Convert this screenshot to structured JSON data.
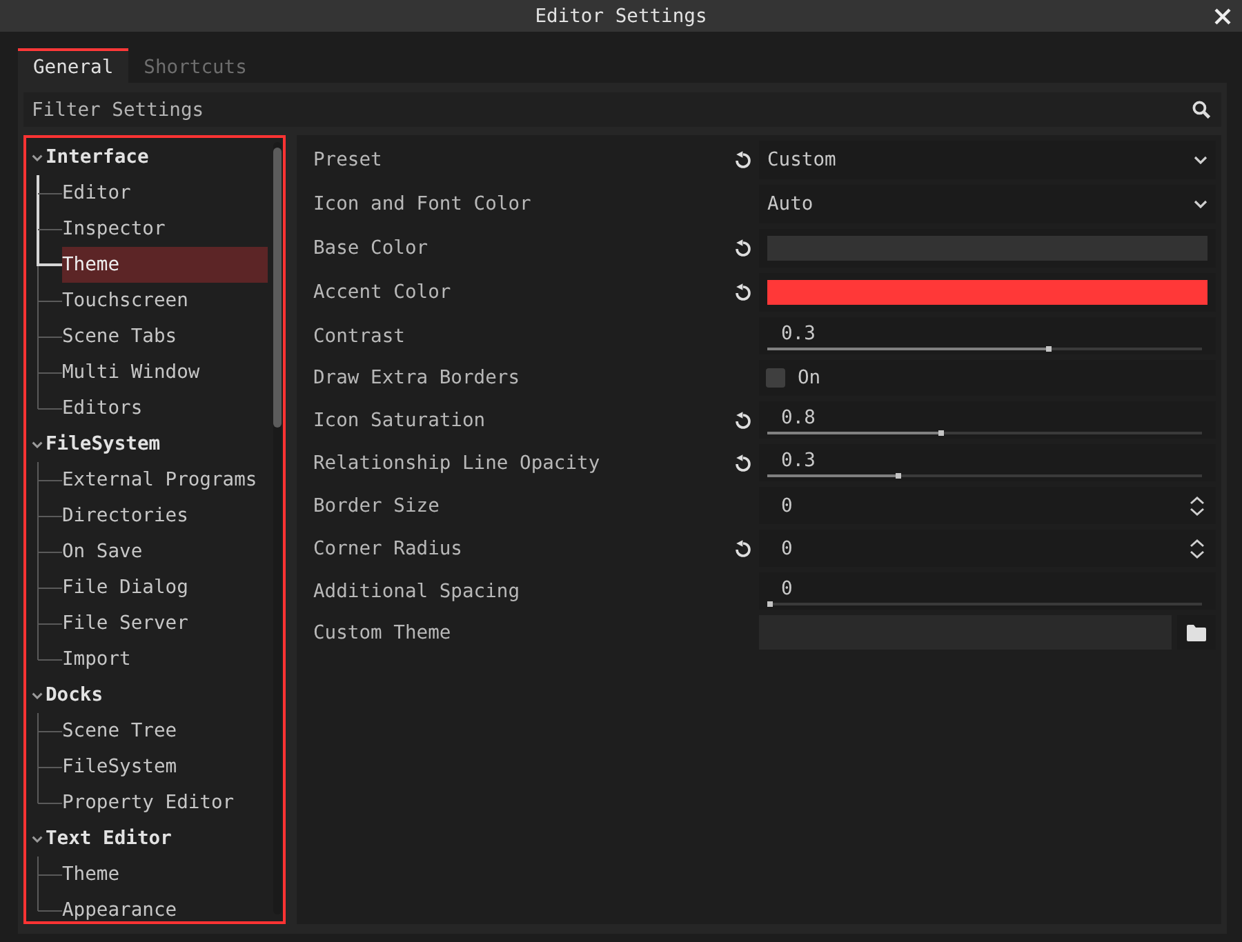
{
  "window": {
    "title": "Editor Settings"
  },
  "tabs": [
    {
      "label": "General",
      "selected": true
    },
    {
      "label": "Shortcuts",
      "selected": false
    }
  ],
  "filter": {
    "placeholder": "Filter Settings"
  },
  "tree": {
    "categories": [
      {
        "label": "Interface",
        "expanded": true,
        "children": [
          {
            "label": "Editor",
            "selected": false
          },
          {
            "label": "Inspector",
            "selected": false
          },
          {
            "label": "Theme",
            "selected": true
          },
          {
            "label": "Touchscreen",
            "selected": false
          },
          {
            "label": "Scene Tabs",
            "selected": false
          },
          {
            "label": "Multi Window",
            "selected": false
          },
          {
            "label": "Editors",
            "selected": false
          }
        ]
      },
      {
        "label": "FileSystem",
        "expanded": true,
        "children": [
          {
            "label": "External Programs",
            "selected": false
          },
          {
            "label": "Directories",
            "selected": false
          },
          {
            "label": "On Save",
            "selected": false
          },
          {
            "label": "File Dialog",
            "selected": false
          },
          {
            "label": "File Server",
            "selected": false
          },
          {
            "label": "Import",
            "selected": false
          }
        ]
      },
      {
        "label": "Docks",
        "expanded": true,
        "children": [
          {
            "label": "Scene Tree",
            "selected": false
          },
          {
            "label": "FileSystem",
            "selected": false
          },
          {
            "label": "Property Editor",
            "selected": false
          }
        ]
      },
      {
        "label": "Text Editor",
        "expanded": true,
        "children": [
          {
            "label": "Theme",
            "selected": false
          },
          {
            "label": "Appearance",
            "selected": false
          }
        ]
      }
    ]
  },
  "inspector": {
    "rows": [
      {
        "kind": "dropdown",
        "label": "Preset",
        "revert": true,
        "value": "Custom"
      },
      {
        "kind": "dropdown",
        "label": "Icon and Font Color",
        "revert": false,
        "value": "Auto"
      },
      {
        "kind": "color",
        "label": "Base Color",
        "revert": true,
        "color": "#333333"
      },
      {
        "kind": "color",
        "label": "Accent Color",
        "revert": true,
        "color": "#ff3838"
      },
      {
        "kind": "slider",
        "label": "Contrast",
        "revert": false,
        "value": "0.3",
        "level": 0.65
      },
      {
        "kind": "checkbox",
        "label": "Draw Extra Borders",
        "revert": false,
        "checked": false,
        "value": "On"
      },
      {
        "kind": "slider",
        "label": "Icon Saturation",
        "revert": true,
        "value": "0.8",
        "level": 0.4
      },
      {
        "kind": "slider",
        "label": "Relationship Line Opacity",
        "revert": true,
        "value": "0.3",
        "level": 0.3
      },
      {
        "kind": "spin",
        "label": "Border Size",
        "revert": false,
        "value": "0"
      },
      {
        "kind": "spin",
        "label": "Corner Radius",
        "revert": true,
        "value": "0"
      },
      {
        "kind": "slider",
        "label": "Additional Spacing",
        "revert": false,
        "value": "0",
        "level": 0
      },
      {
        "kind": "file",
        "label": "Custom Theme",
        "revert": false
      }
    ]
  }
}
